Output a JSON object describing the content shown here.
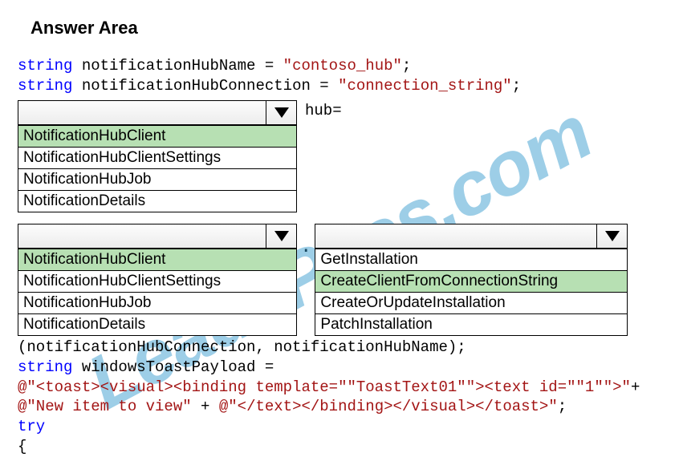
{
  "title": "Answer Area",
  "watermark": "Lead4Pass.com",
  "code": {
    "kw_string": "string",
    "var1": " notificationHubName = ",
    "str1": "\"contoso_hub\"",
    "semi": ";",
    "var2": " notificationHubConnection = ",
    "str2": "\"connection_string\"",
    "hub_eq": " hub=",
    "dot": "."
  },
  "dropdown_a": {
    "items": [
      "NotificationHubClient",
      "NotificationHubClientSettings",
      "NotificationHubJob",
      "NotificationDetails"
    ],
    "selected_index": 0
  },
  "dropdown_b": {
    "items": [
      "NotificationHubClient",
      "NotificationHubClientSettings",
      "NotificationHubJob",
      "NotificationDetails"
    ],
    "selected_index": 0
  },
  "dropdown_c": {
    "items": [
      "GetInstallation",
      "CreateClientFromConnectionString",
      "CreateOrUpdateInstallation",
      "PatchInstallation"
    ],
    "selected_index": 1
  },
  "bottom": {
    "line1": "(notificationHubConnection, notificationHubName);",
    "line2a": "string",
    "line2b": " windowsToastPayload =",
    "line3": "@\"<toast><visual><binding template=\"\"ToastText01\"\"><text id=\"\"1\"\">\"",
    "line3end": "+",
    "line4a": "@\"New item to view\"",
    "line4b": " + ",
    "line4c": "@\"</text></binding></visual></toast>\"",
    "line4d": ";",
    "line5": "try",
    "line6": "{"
  }
}
